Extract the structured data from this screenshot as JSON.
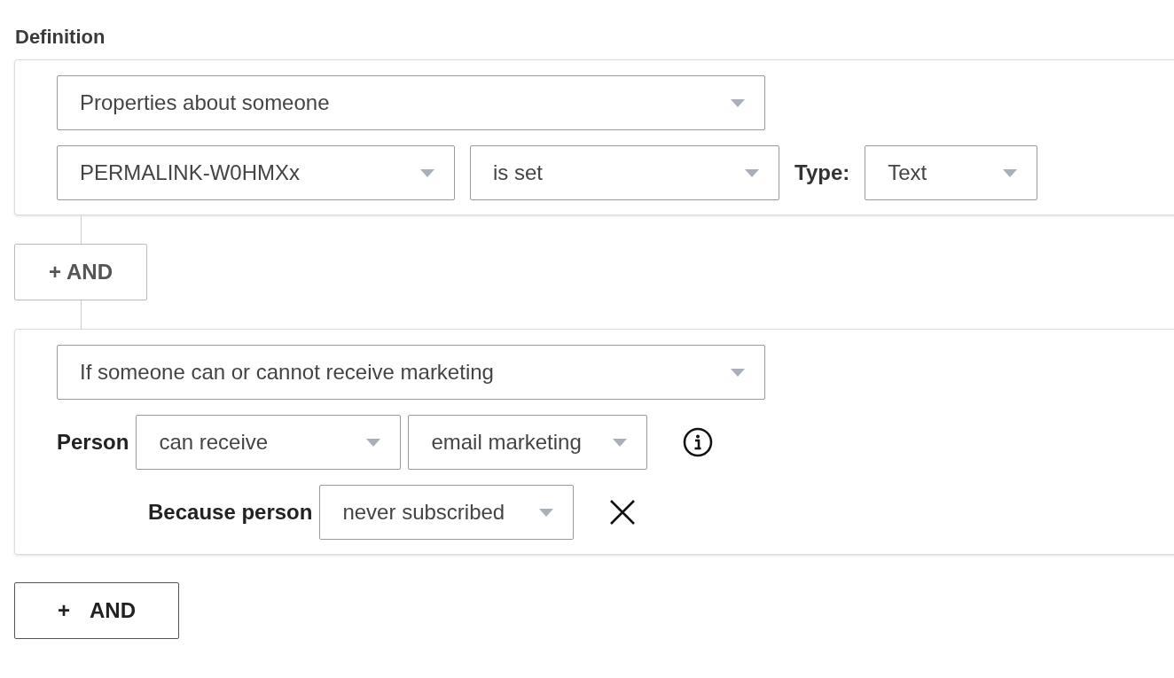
{
  "section_label": "Definition",
  "conditions": [
    {
      "rows": [
        {
          "kind": "main",
          "items": [
            {
              "kind": "dropdown",
              "value": "Properties about someone"
            }
          ]
        },
        {
          "kind": "main",
          "items": [
            {
              "kind": "dropdown",
              "value": "PERMALINK-W0HMXx"
            },
            {
              "kind": "dropdown",
              "value": "is set"
            },
            {
              "kind": "label",
              "text": "Type:"
            },
            {
              "kind": "dropdown",
              "value": "Text"
            }
          ]
        }
      ]
    },
    {
      "rows": [
        {
          "kind": "main",
          "items": [
            {
              "kind": "dropdown",
              "value": "If someone can or cannot receive marketing"
            }
          ]
        },
        {
          "kind": "main",
          "items": [
            {
              "kind": "label",
              "text": "Person"
            },
            {
              "kind": "dropdown",
              "value": "can receive"
            },
            {
              "kind": "dropdown",
              "value": "email marketing"
            },
            {
              "kind": "info"
            }
          ]
        },
        {
          "kind": "sub",
          "items": [
            {
              "kind": "label",
              "text": "Because person"
            },
            {
              "kind": "dropdown",
              "value": "never subscribed"
            },
            {
              "kind": "remove"
            }
          ]
        }
      ]
    }
  ],
  "connector_button": {
    "icon": "+",
    "label": "AND"
  },
  "add_button": {
    "icon": "+",
    "label": "AND"
  }
}
